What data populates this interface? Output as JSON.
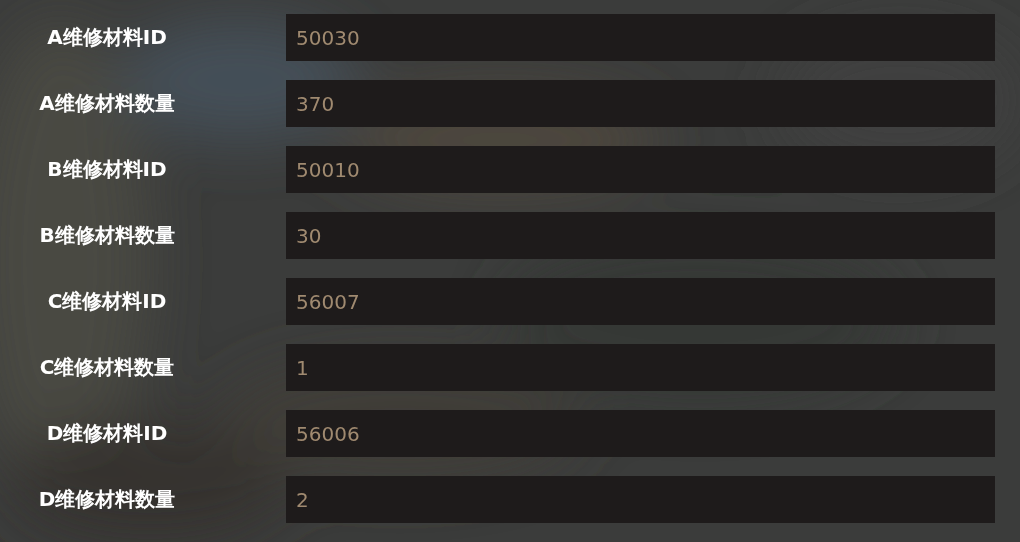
{
  "fields": [
    {
      "label": "A维修材料ID",
      "value": "50030"
    },
    {
      "label": "A维修材料数量",
      "value": "370"
    },
    {
      "label": "B维修材料ID",
      "value": "50010"
    },
    {
      "label": "B维修材料数量",
      "value": "30"
    },
    {
      "label": "C维修材料ID",
      "value": "56007"
    },
    {
      "label": "C维修材料数量",
      "value": "1"
    },
    {
      "label": "D维修材料ID",
      "value": "56006"
    },
    {
      "label": "D维修材料数量",
      "value": "2"
    }
  ]
}
